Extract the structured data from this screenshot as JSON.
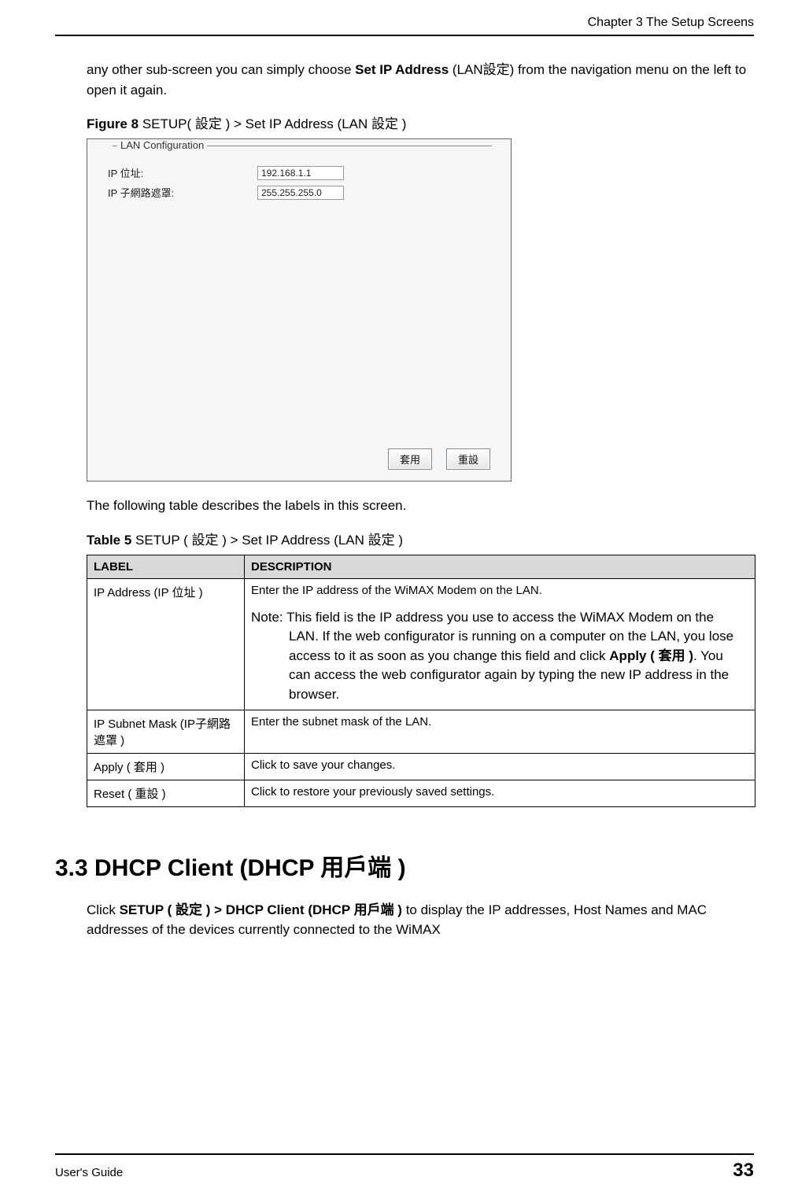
{
  "header": {
    "chapter": "Chapter 3 The Setup Screens"
  },
  "intro": {
    "pre": "any other sub-screen you can simply choose ",
    "bold1": "Set IP Address",
    "mid": " (LAN",
    "bold2": "設定)",
    "post": " from the navigation menu on the left to open it again."
  },
  "figure": {
    "label": "Figure 8",
    "caption": "   SETUP( 設定 ) > Set IP Address  (LAN 設定 )"
  },
  "screenshot": {
    "legend": "LAN Configuration",
    "rows": [
      {
        "label": "IP 位址:",
        "value": "192.168.1.1"
      },
      {
        "label": "IP 子網路遮罩:",
        "value": "255.255.255.0"
      }
    ],
    "apply": "套用",
    "reset": "重設"
  },
  "para_after_figure": "The following table describes the labels in this screen.",
  "table_caption": {
    "label": "Table 5",
    "caption": "   SETUP  ( 設定 ) > Set IP Address  (LAN 設定 )"
  },
  "table": {
    "headers": {
      "label": "LABEL",
      "desc": "DESCRIPTION"
    },
    "rows": [
      {
        "label": "IP Address  (IP 位址 )",
        "desc_line": "Enter the IP address of the WiMAX Modem on the LAN.",
        "note_prefix": "Note: ",
        "note_body_a": "This field is the IP address you use to access the WiMAX Modem on the LAN. If the web configurator is running on a computer on the LAN, you lose access to it as soon as you change this field and click ",
        "note_bold": "Apply ( 套用 )",
        "note_body_b": ". You can access the web configurator again by typing the new IP address in the browser."
      },
      {
        "label": "IP Subnet Mask (IP子網路遮罩 )",
        "desc_line": "Enter the subnet mask of the LAN."
      },
      {
        "label": "Apply ( 套用 )",
        "desc_line": "Click to save your changes."
      },
      {
        "label": "Reset ( 重設 )",
        "desc_line": "Click to restore your previously saved settings."
      }
    ]
  },
  "section": {
    "num": "3.3",
    "title": "  DHCP Client (DHCP 用戶端 )"
  },
  "section_para": {
    "pre": "Click ",
    "bold": "SETUP  ( 設定 ) > DHCP Client  (DHCP 用戶端 )",
    "post": " to display the IP addresses, Host Names and MAC addresses of the devices currently connected to the WiMAX"
  },
  "footer": {
    "left": "User's Guide",
    "page": "33"
  }
}
